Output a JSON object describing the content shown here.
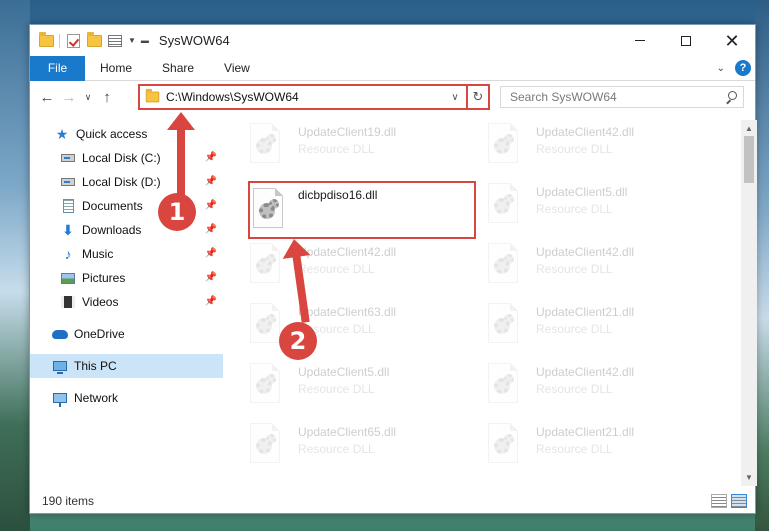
{
  "window": {
    "title": "SysWOW64"
  },
  "ribbon": {
    "tabs": [
      "File",
      "Home",
      "Share",
      "View"
    ]
  },
  "nav": {
    "address_path": "C:\\Windows\\SysWOW64",
    "search_placeholder": "Search SysWOW64"
  },
  "sidebar": {
    "items": [
      {
        "label": "Quick access",
        "icon": "star-icon"
      },
      {
        "label": "Local Disk (C:)",
        "icon": "disk-icon",
        "pinned": true
      },
      {
        "label": "Local Disk (D:)",
        "icon": "disk-icon",
        "pinned": true
      },
      {
        "label": "Documents",
        "icon": "documents-icon",
        "pinned": true
      },
      {
        "label": "Downloads",
        "icon": "download-icon",
        "pinned": true
      },
      {
        "label": "Music",
        "icon": "music-icon",
        "pinned": true
      },
      {
        "label": "Pictures",
        "icon": "pictures-icon",
        "pinned": true
      },
      {
        "label": "Videos",
        "icon": "videos-icon",
        "pinned": true
      },
      {
        "label": "OneDrive",
        "icon": "cloud-icon"
      },
      {
        "label": "This PC",
        "icon": "computer-icon",
        "selected": true
      },
      {
        "label": "Network",
        "icon": "network-icon"
      }
    ]
  },
  "files": {
    "type_label": "Resource DLL",
    "left": [
      "UpdateClient19.dll",
      "dicbpdiso16.dll",
      "UpdateClient42.dll",
      "UpdateClient63.dll",
      "UpdateClient5.dll",
      "UpdateClient65.dll"
    ],
    "right": [
      "UpdateClient42.dll",
      "UpdateClient5.dll",
      "UpdateClient42.dll",
      "UpdateClient21.dll",
      "UpdateClient42.dll",
      "UpdateClient21.dll"
    ],
    "highlighted": "dicbpdiso16.dll"
  },
  "status": {
    "item_count": "190 items"
  },
  "annotations": {
    "step1": "1",
    "step2": "2",
    "color": "#d9453f"
  }
}
